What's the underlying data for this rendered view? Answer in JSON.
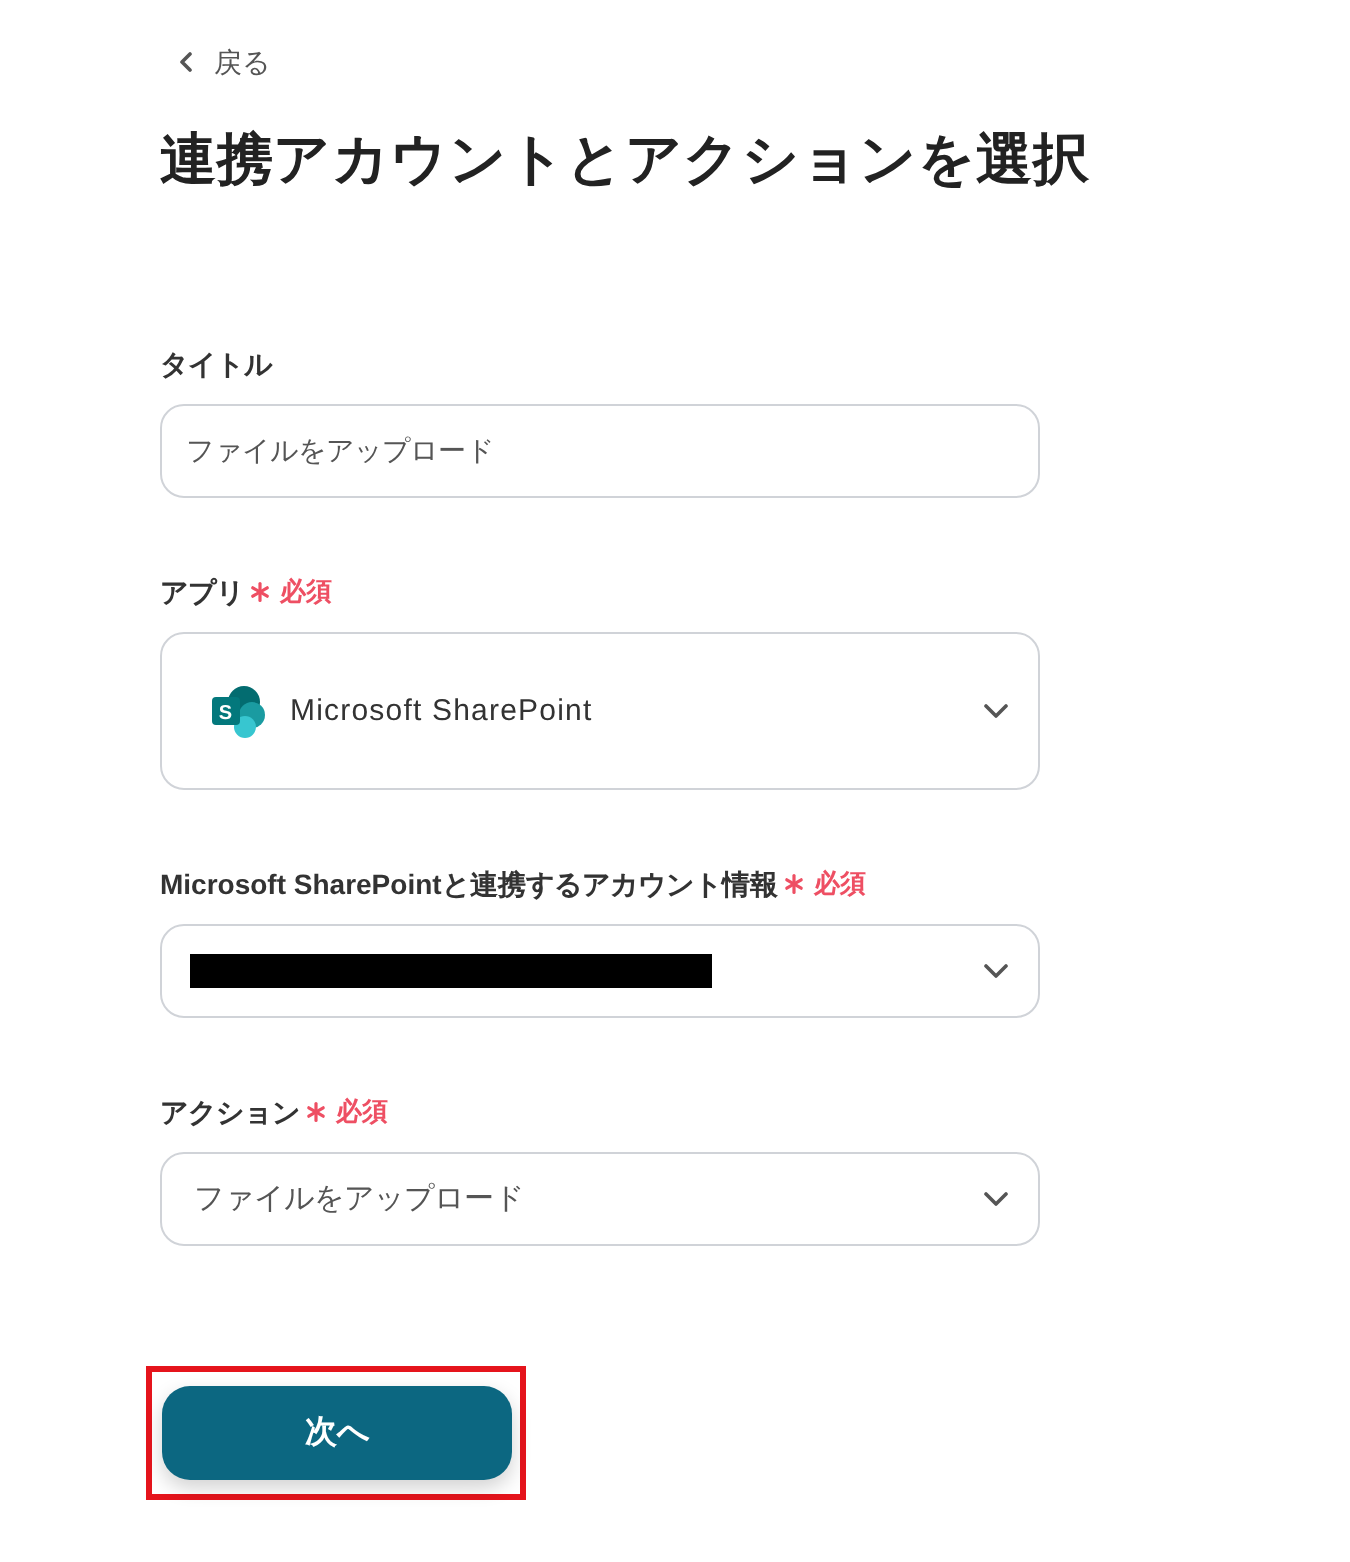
{
  "back_link": {
    "label": "戻る"
  },
  "page_title": "連携アカウントとアクションを選択",
  "fields": [
    {
      "kind": "text_input",
      "label": "タイトル",
      "required": false,
      "value": "ファイルをアップロード"
    },
    {
      "kind": "app_select",
      "label": "アプリ",
      "required": true,
      "required_label": "必須",
      "value": "Microsoft SharePoint",
      "logo_letter": "S"
    },
    {
      "kind": "redacted_select",
      "label": "Microsoft SharePointと連携するアカウント情報",
      "required": true,
      "required_label": "必須"
    },
    {
      "kind": "select",
      "label": "アクション",
      "required": true,
      "required_label": "必須",
      "value": "ファイルをアップロード"
    }
  ],
  "next_button": {
    "label": "次へ",
    "highlighted": true
  }
}
